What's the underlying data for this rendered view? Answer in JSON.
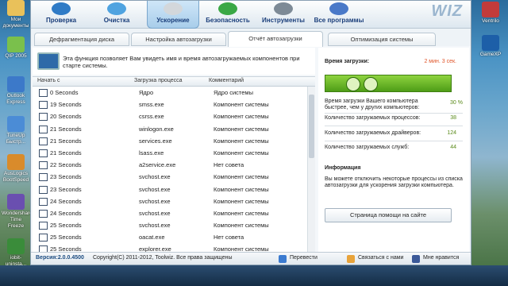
{
  "desktop_left": [
    {
      "label": "Мои документы",
      "color": "#e9c15a"
    },
    {
      "label": "QIP 2005",
      "color": "#7ac04c"
    },
    {
      "label": "Outlook Express",
      "color": "#3c79c9"
    },
    {
      "label": "TuneUp Быстр...",
      "color": "#4b8cd6"
    },
    {
      "label": "AusLogics BootSpeed",
      "color": "#d98b2b"
    },
    {
      "label": "Wondershare Time Freeze",
      "color": "#6a4fb0"
    },
    {
      "label": "iobit-uninsta...",
      "color": "#3a8c3a"
    }
  ],
  "desktop_right": [
    {
      "label": "Ventrilo",
      "color": "#c23b3b"
    },
    {
      "label": "GameXP",
      "color": "#1d5fa8"
    }
  ],
  "toolbar": {
    "logo": "WIZ",
    "buttons": [
      {
        "label": "Проверка",
        "color": "#2f7bc6"
      },
      {
        "label": "Очистка",
        "color": "#4fa3e0"
      },
      {
        "label": "Ускорение",
        "color": "#d3d7db"
      },
      {
        "label": "Безопасность",
        "color": "#3aa845"
      },
      {
        "label": "Инструменты",
        "color": "#7d8a96"
      },
      {
        "label": "Все программы",
        "color": "#4a79c8"
      }
    ]
  },
  "tabs": [
    "Дефрагментация диска",
    "Настройка автозагрузки",
    "Отчёт автозагрузки",
    "Оптимизация системы"
  ],
  "info_text": "Эта функция позволяет Вам увидеть имя и время автозагружаемых компонентов при старте системы.",
  "table": {
    "headers": [
      "Начать с",
      "Загрузка процесса",
      "Комментарий"
    ],
    "rows": [
      [
        "0 Seconds",
        "Ядро",
        "Ядро системы"
      ],
      [
        "19 Seconds",
        "smss.exe",
        "Компонент системы"
      ],
      [
        "20 Seconds",
        "csrss.exe",
        "Компонент системы"
      ],
      [
        "21 Seconds",
        "winlogon.exe",
        "Компонент системы"
      ],
      [
        "21 Seconds",
        "services.exe",
        "Компонент системы"
      ],
      [
        "21 Seconds",
        "lsass.exe",
        "Компонент системы"
      ],
      [
        "22 Seconds",
        "a2service.exe",
        "Нет совета"
      ],
      [
        "23 Seconds",
        "svchost.exe",
        "Компонент системы"
      ],
      [
        "23 Seconds",
        "svchost.exe",
        "Компонент системы"
      ],
      [
        "24 Seconds",
        "svchost.exe",
        "Компонент системы"
      ],
      [
        "24 Seconds",
        "svchost.exe",
        "Компонент системы"
      ],
      [
        "25 Seconds",
        "svchost.exe",
        "Компонент системы"
      ],
      [
        "25 Seconds",
        "oacat.exe",
        "Нет совета"
      ],
      [
        "25 Seconds",
        "explorer.exe",
        "Компонент системы"
      ]
    ]
  },
  "stats": {
    "boot_time_label": "Время загрузки:",
    "boot_time_value": "2 мин. 3 сек.",
    "faster_label": "Время загрузки Вашего компьютера быстрее, чем у других компьютеров:",
    "faster_value": "30 %",
    "procs_label": "Количество загружаемых процессов:",
    "procs_value": "38",
    "drivers_label": "Количество загружаемых драйверов:",
    "drivers_value": "124",
    "services_label": "Количество загружаемых служб:",
    "services_value": "44",
    "info_title": "Информация",
    "info_body": "Вы можете отключить некоторые процессы из списка автозагрузки для ускорения загрузки компьютера.",
    "help_button": "Страница помощи на сайте"
  },
  "status": {
    "version": "Версия:2.0.0.4500",
    "copyright": "Copyright(C) 2011-2012, Toolwiz. Все права защищены",
    "translate": "Перевести",
    "contact": "Связаться с нами",
    "like": "Мне нравится"
  }
}
